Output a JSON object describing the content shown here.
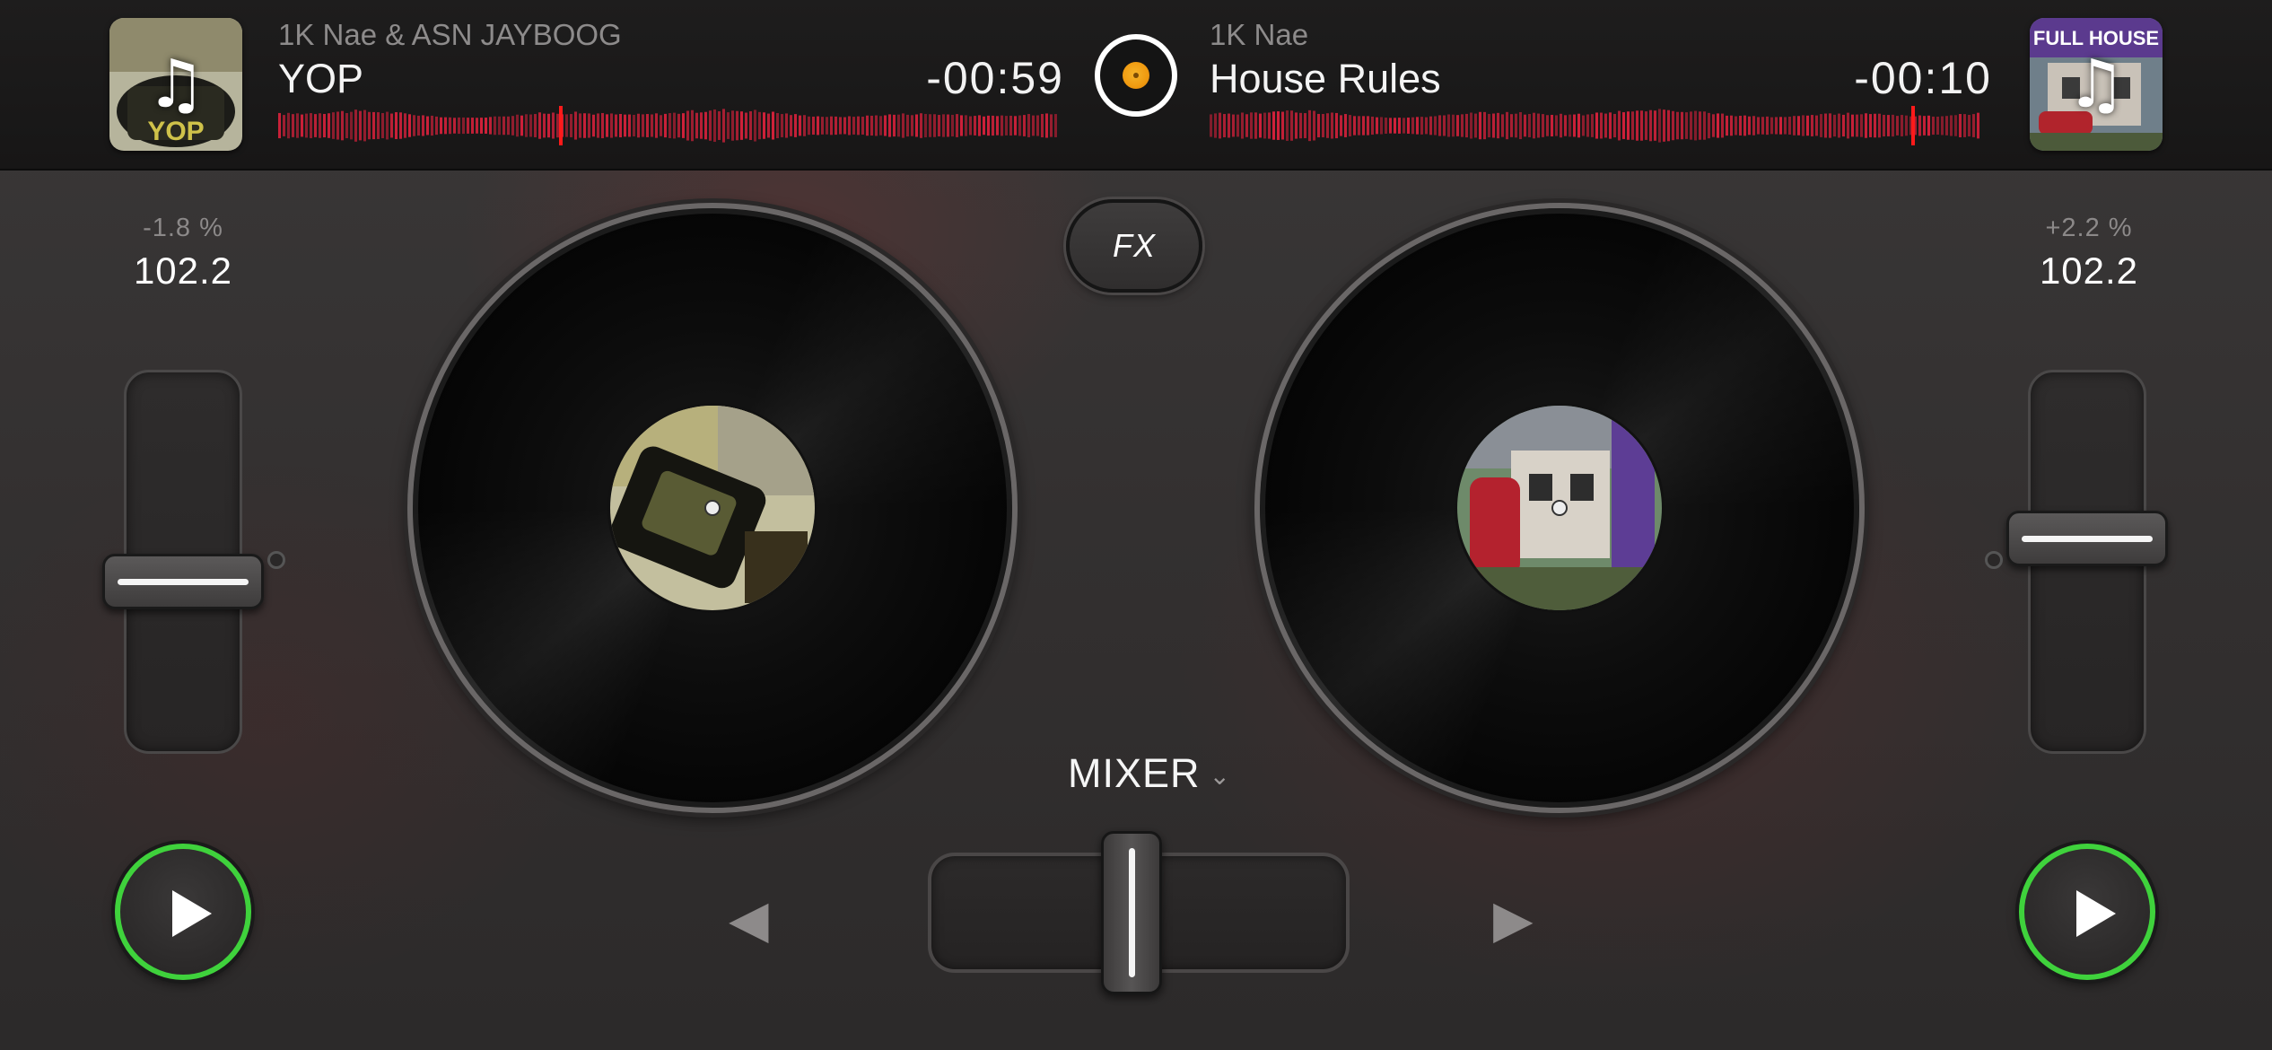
{
  "deck_left": {
    "artist": "1K Nae & ASN JAYBOOG",
    "title": "YOP",
    "time_remaining": "-00:59",
    "pitch": "-1.8 %",
    "bpm": "102.2",
    "cover_text": "YOP",
    "playhead_fraction": 0.36,
    "pitch_fader_fraction": 0.56
  },
  "deck_right": {
    "artist": "1K Nae",
    "title": "House Rules",
    "time_remaining": "-00:10",
    "pitch": "+2.2 %",
    "bpm": "102.2",
    "cover_text": "FULL HOUSE",
    "playhead_fraction": 0.907,
    "pitch_fader_fraction": 0.43
  },
  "fx_label": "FX",
  "mixer": {
    "label": "MIXER",
    "crossfader_fraction": 0.48
  },
  "icons": {
    "cover_placeholder": "music-note-icon",
    "sync": "sync-disc-icon",
    "play": "play-icon",
    "nudge_left": "triangle-left-icon",
    "nudge_right": "triangle-right-icon",
    "dropdown": "chevron-down-icon"
  },
  "colors": {
    "waveform": "#d0213a",
    "playhead": "#ff1a1a",
    "play_ring": "#3fd23c",
    "sync_dot": "#f09a10",
    "background": "#333030"
  }
}
